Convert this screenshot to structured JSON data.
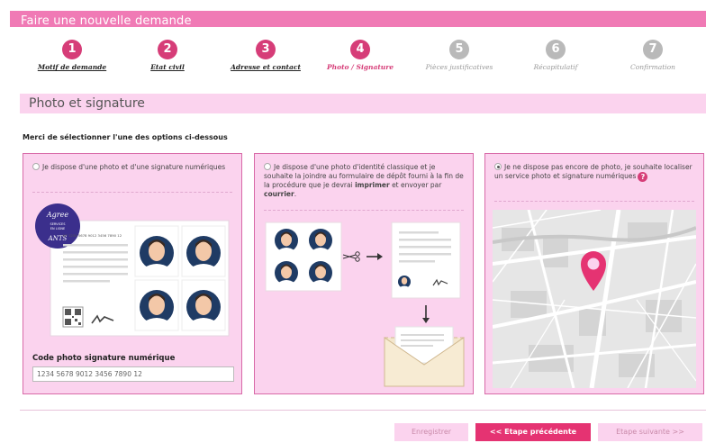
{
  "page_title": "Faire une nouvelle demande",
  "steps": [
    {
      "num": "1",
      "label": "Motif de demande"
    },
    {
      "num": "2",
      "label": "Etat civil"
    },
    {
      "num": "3",
      "label": "Adresse et contact"
    },
    {
      "num": "4",
      "label": "Photo / Signature"
    },
    {
      "num": "5",
      "label": "Pièces justificatives"
    },
    {
      "num": "6",
      "label": "Récapitulatif"
    },
    {
      "num": "7",
      "label": "Confirmation"
    }
  ],
  "section_title": "Photo et signature",
  "instruction": "Merci de sélectionner l'une des options ci-dessous",
  "option1": {
    "label": "Je dispose d'une photo et d'une signature numériques",
    "badge_lines": [
      "Agree",
      "SERVICES",
      "EN LIGNE",
      "ANTS"
    ],
    "board_code": "N° 1234 5678 9012 3456 7890 12",
    "code_label": "Code photo signature numérique",
    "code_value": "1234 5678 9012 3456 7890 12"
  },
  "option2": {
    "text_1": "Je dispose d'une photo d'identité classique et je souhaite la joindre au formulaire de dépôt fourni à la fin de la procédure que je devrai ",
    "bold_1": "imprimer",
    "text_2": " et envoyer par ",
    "bold_2": "courrier",
    "text_3": "."
  },
  "option3": {
    "label": "Je ne dispose pas encore de photo, je souhaite localiser un service photo et signature numériques",
    "help": "?"
  },
  "buttons": {
    "save": "Enregistrer",
    "prev": "<< Etape précédente",
    "next": "Etape suivante  >>"
  },
  "colors": {
    "accent": "#e53372",
    "title_bar": "#f07ab5",
    "panel": "#fbd3ee",
    "step_active": "#d63d78",
    "step_inactive": "#b9b9b9"
  },
  "icons": [
    "scissors-icon",
    "arrow-right-icon",
    "arrow-down-icon",
    "qr-code-icon",
    "signature-icon",
    "map-pin-icon",
    "envelope-icon",
    "help-icon"
  ]
}
